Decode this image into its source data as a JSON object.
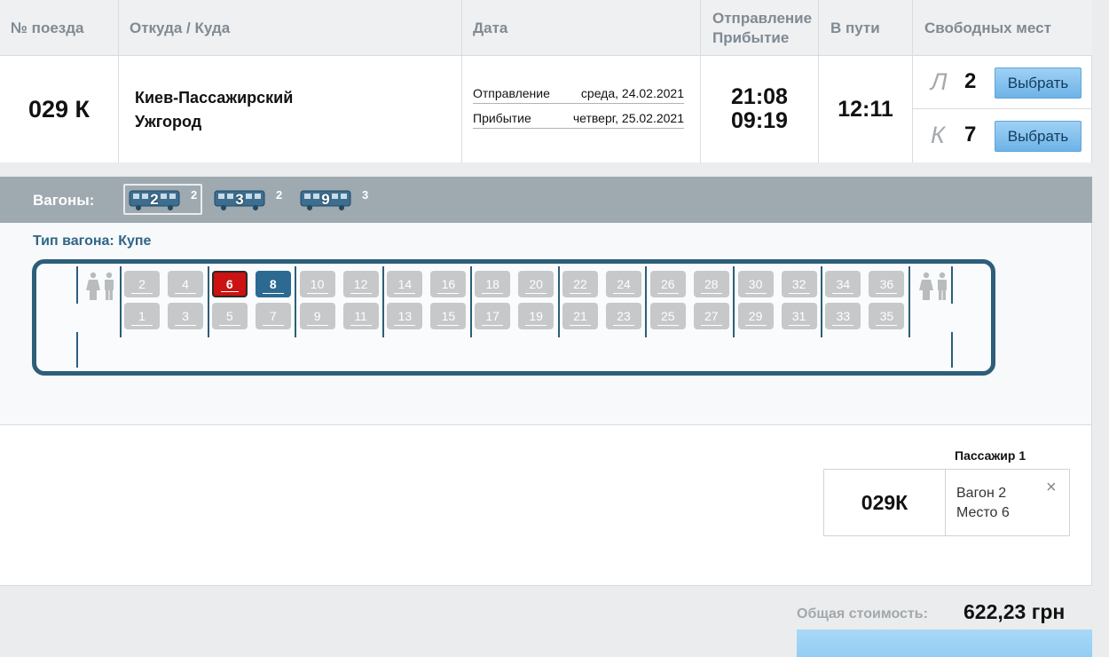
{
  "table": {
    "headers": {
      "train_no": "№ поезда",
      "route": "Откуда / Куда",
      "date": "Дата",
      "dep_arr_1": "Отправление",
      "dep_arr_2": "Прибытие",
      "travel": "В пути",
      "free": "Свободных мест"
    },
    "row": {
      "train_no": "029 К",
      "from": "Киев-Пассажирский",
      "to": "Ужгород",
      "dep_label": "Отправление",
      "dep_date": "среда, 24.02.2021",
      "arr_label": "Прибытие",
      "arr_date": "четверг, 25.02.2021",
      "dep_time": "21:08",
      "arr_time": "09:19",
      "travel_time": "12:11",
      "classes": [
        {
          "cls": "Л",
          "count": "2",
          "button": "Выбрать"
        },
        {
          "cls": "К",
          "count": "7",
          "button": "Выбрать"
        }
      ]
    }
  },
  "wagons": {
    "label": "Вагоны:",
    "items": [
      {
        "number": "2",
        "count": "2",
        "selected": true
      },
      {
        "number": "3",
        "count": "2",
        "selected": false
      },
      {
        "number": "9",
        "count": "3",
        "selected": false
      }
    ]
  },
  "scheme": {
    "type_label": "Тип вагона: Купе",
    "top_seats": [
      "2",
      "4",
      "6",
      "8",
      "10",
      "12",
      "14",
      "16",
      "18",
      "20",
      "22",
      "24",
      "26",
      "28",
      "30",
      "32",
      "34",
      "36"
    ],
    "bottom_seats": [
      "1",
      "3",
      "5",
      "7",
      "9",
      "11",
      "13",
      "15",
      "17",
      "19",
      "21",
      "23",
      "25",
      "27",
      "29",
      "31",
      "33",
      "35"
    ],
    "selected_seat": "6",
    "available_seats": [
      "8"
    ]
  },
  "passenger": {
    "title": "Пассажир 1",
    "train": "029К",
    "wagon": "Вагон 2",
    "seat": "Место 6",
    "close": "×"
  },
  "footer": {
    "total_label": "Общая стоимость:",
    "total_value": "622,23 грн"
  },
  "colors": {
    "accent_dark": "#2d5e7a",
    "seat_selected": "#cc1212",
    "seat_available": "#2c6a91",
    "button": "#7dbdea"
  }
}
